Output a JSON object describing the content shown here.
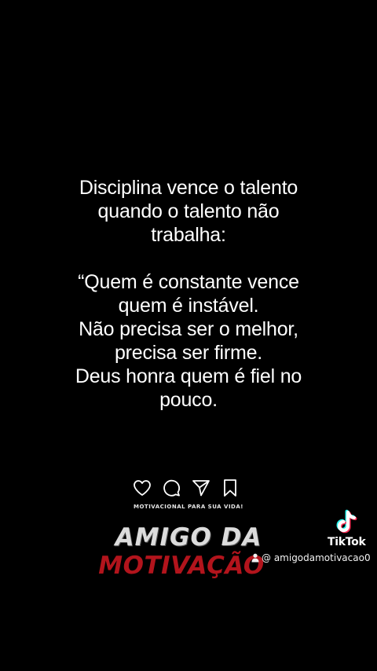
{
  "quote": {
    "heading_lines": [
      "Disciplina vence o talento",
      "quando o talento não",
      "trabalha:"
    ],
    "body_lines": [
      "“Quem é constante vence",
      "quem é instável.",
      "Não precisa ser o melhor,",
      "precisa ser firme.",
      "Deus honra quem é fiel no",
      "pouco."
    ]
  },
  "actions": {
    "icons": [
      "heart-icon",
      "comment-icon",
      "send-icon",
      "bookmark-icon"
    ]
  },
  "brand": {
    "tagline": "MOTIVACIONAL PARA SUA VIDA!",
    "line1": "AMIGO DA",
    "line2": "MOTIVAÇÃO",
    "line1_color": "#dcdcdc",
    "line2_color": "#b2141c"
  },
  "watermark": {
    "platform": "TikTok",
    "handle": "@ amigodamotivacao0",
    "accent_cyan": "#25f4ee",
    "accent_red": "#fe2c55"
  }
}
